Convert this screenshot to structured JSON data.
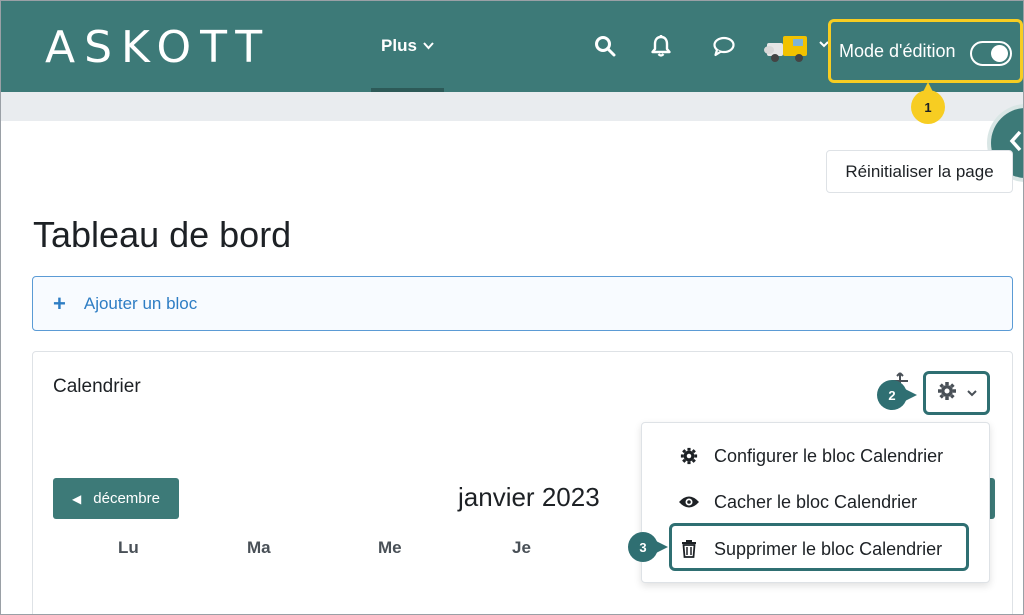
{
  "header": {
    "logo_text": "ASKOTT",
    "plus_label": "Plus",
    "edit_mode_label": "Mode d'édition",
    "edit_mode_on": true,
    "icons": [
      "search-icon",
      "bell-icon",
      "chat-icon",
      "avatar",
      "chevron-down-icon"
    ]
  },
  "callouts": {
    "one": "1",
    "two": "2",
    "three": "3"
  },
  "main": {
    "reset_button": "Réinitialiser la page",
    "page_title": "Tableau de bord",
    "add_block": "Ajouter un bloc"
  },
  "calendar_block": {
    "title": "Calendrier",
    "prev_month": "décembre",
    "current_month": "janvier 2023",
    "day_names": [
      "Lu",
      "Ma",
      "Me",
      "Je"
    ]
  },
  "block_menu": {
    "configure": "Configurer le bloc Calendrier",
    "hide": "Cacher le bloc Calendrier",
    "delete": "Supprimer le bloc Calendrier"
  },
  "colors": {
    "navbar": "#3d7a78",
    "highlight_yellow": "#f7cd22",
    "callout_teal": "#2f6f72",
    "link_blue": "#2e7dc4"
  }
}
